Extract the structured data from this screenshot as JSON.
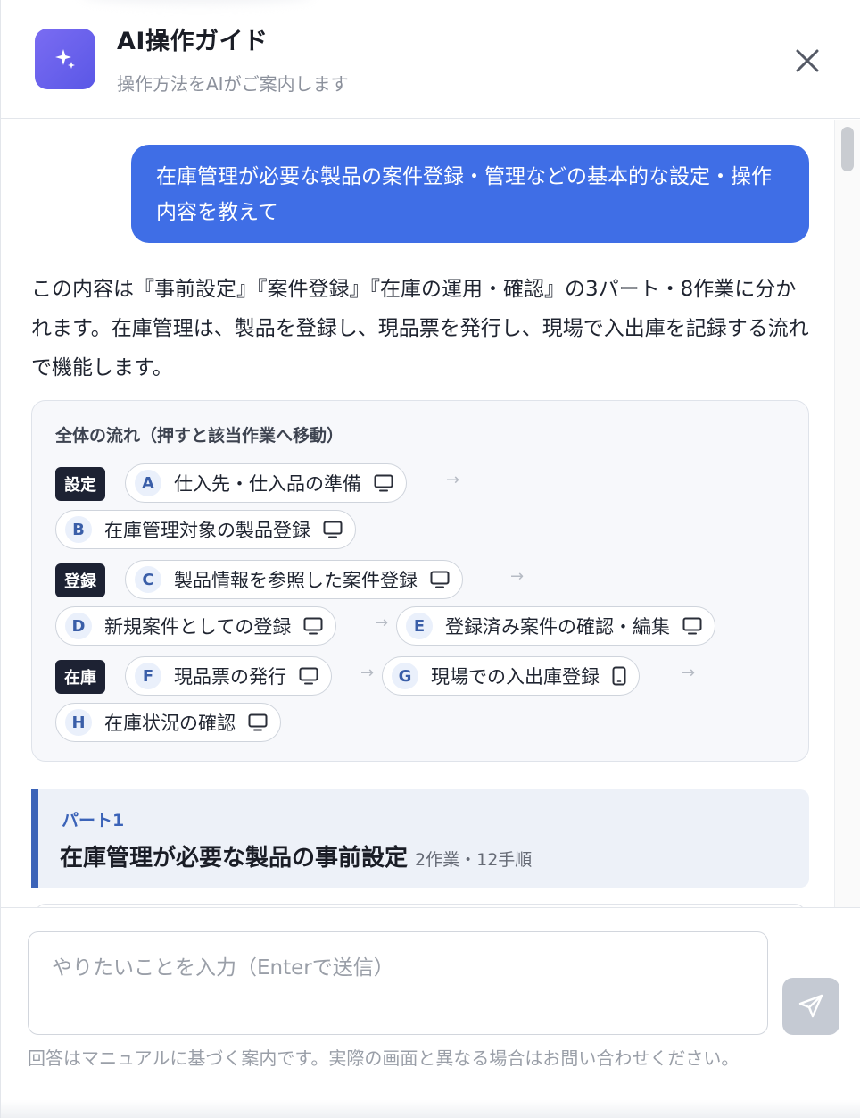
{
  "header": {
    "title": "AI操作ガイド",
    "subtitle": "操作方法をAIがご案内します",
    "logo_icon": "sparkle-icon",
    "close_icon": "close-icon"
  },
  "chat": {
    "user_message": "在庫管理が必要な製品の案件登録・管理などの基本的な設定・操作内容を教えて",
    "assistant_intro": "この内容は『事前設定』『案件登録』『在庫の運用・確認』の3パート・8作業に分かれます。在庫管理は、製品を登録し、現品票を発行し、現場で入出庫を記録する流れで機能します。",
    "flow": {
      "title": "全体の流れ（押すと該当作業へ移動）",
      "groups": [
        {
          "tag": "設定"
        },
        {
          "tag": "登録"
        },
        {
          "tag": "在庫"
        }
      ],
      "steps": [
        {
          "letter": "A",
          "label": "仕入先・仕入品の準備",
          "device": "desktop-icon"
        },
        {
          "letter": "B",
          "label": "在庫管理対象の製品登録",
          "device": "desktop-icon"
        },
        {
          "letter": "C",
          "label": "製品情報を参照した案件登録",
          "device": "desktop-icon"
        },
        {
          "letter": "D",
          "label": "新規案件としての登録",
          "device": "desktop-icon"
        },
        {
          "letter": "E",
          "label": "登録済み案件の確認・編集",
          "device": "desktop-icon"
        },
        {
          "letter": "F",
          "label": "現品票の発行",
          "device": "desktop-icon"
        },
        {
          "letter": "G",
          "label": "現場での入出庫登録",
          "device": "mobile-icon"
        },
        {
          "letter": "H",
          "label": "在庫状況の確認",
          "device": "desktop-icon"
        }
      ]
    },
    "part": {
      "label": "パート1",
      "title": "在庫管理が必要な製品の事前設定",
      "meta": "2作業・12手順"
    }
  },
  "composer": {
    "placeholder": "やりたいことを入力（Enterで送信）",
    "value": "",
    "send_icon": "send-icon",
    "disclaimer": "回答はマニュアルに基づく案内です。実際の画面と異なる場合はお問い合わせください。"
  },
  "colors": {
    "accent": "#3f6ee6",
    "logo_gradient_start": "#7a6cf2",
    "logo_gradient_end": "#5a57e6",
    "tag_bg": "#1d2233",
    "part_accent": "#3b63b8"
  }
}
